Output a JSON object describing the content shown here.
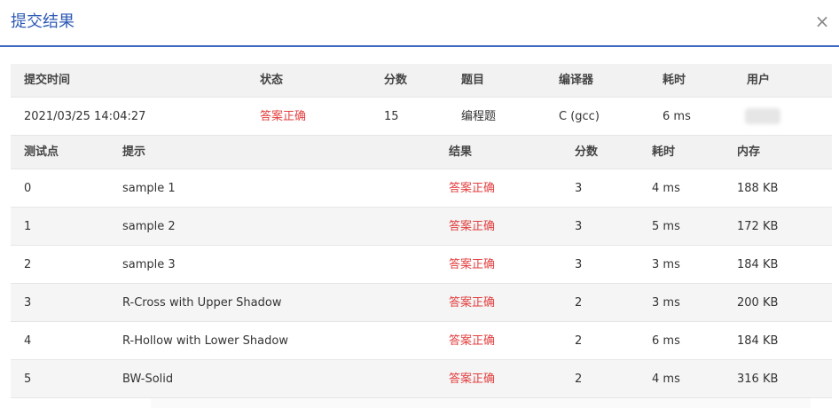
{
  "modal": {
    "title": "提交结果",
    "close_glyph": "×"
  },
  "submission": {
    "headers": [
      "提交时间",
      "状态",
      "分数",
      "题目",
      "编译器",
      "耗时",
      "用户"
    ],
    "row": {
      "time": "2021/03/25 14:04:27",
      "status": "答案正确",
      "score": "15",
      "problem": "编程题",
      "compiler": "C (gcc)",
      "duration": "6 ms"
    }
  },
  "testcases": {
    "headers": [
      "测试点",
      "提示",
      "结果",
      "分数",
      "耗时",
      "内存"
    ],
    "rows": [
      {
        "id": "0",
        "hint": "sample 1",
        "result": "答案正确",
        "score": "3",
        "time": "4 ms",
        "memory": "188 KB"
      },
      {
        "id": "1",
        "hint": "sample 2",
        "result": "答案正确",
        "score": "3",
        "time": "5 ms",
        "memory": "172 KB"
      },
      {
        "id": "2",
        "hint": "sample 3",
        "result": "答案正确",
        "score": "3",
        "time": "3 ms",
        "memory": "184 KB"
      },
      {
        "id": "3",
        "hint": "R-Cross with Upper Shadow",
        "result": "答案正确",
        "score": "2",
        "time": "3 ms",
        "memory": "200 KB"
      },
      {
        "id": "4",
        "hint": "R-Hollow with Lower Shadow",
        "result": "答案正确",
        "score": "2",
        "time": "6 ms",
        "memory": "184 KB"
      },
      {
        "id": "5",
        "hint": "BW-Solid",
        "result": "答案正确",
        "score": "2",
        "time": "4 ms",
        "memory": "316 KB"
      }
    ]
  },
  "colors": {
    "accent": "#2d5ab5",
    "divider": "#3e6bc1",
    "success_text": "#e23f3f"
  }
}
